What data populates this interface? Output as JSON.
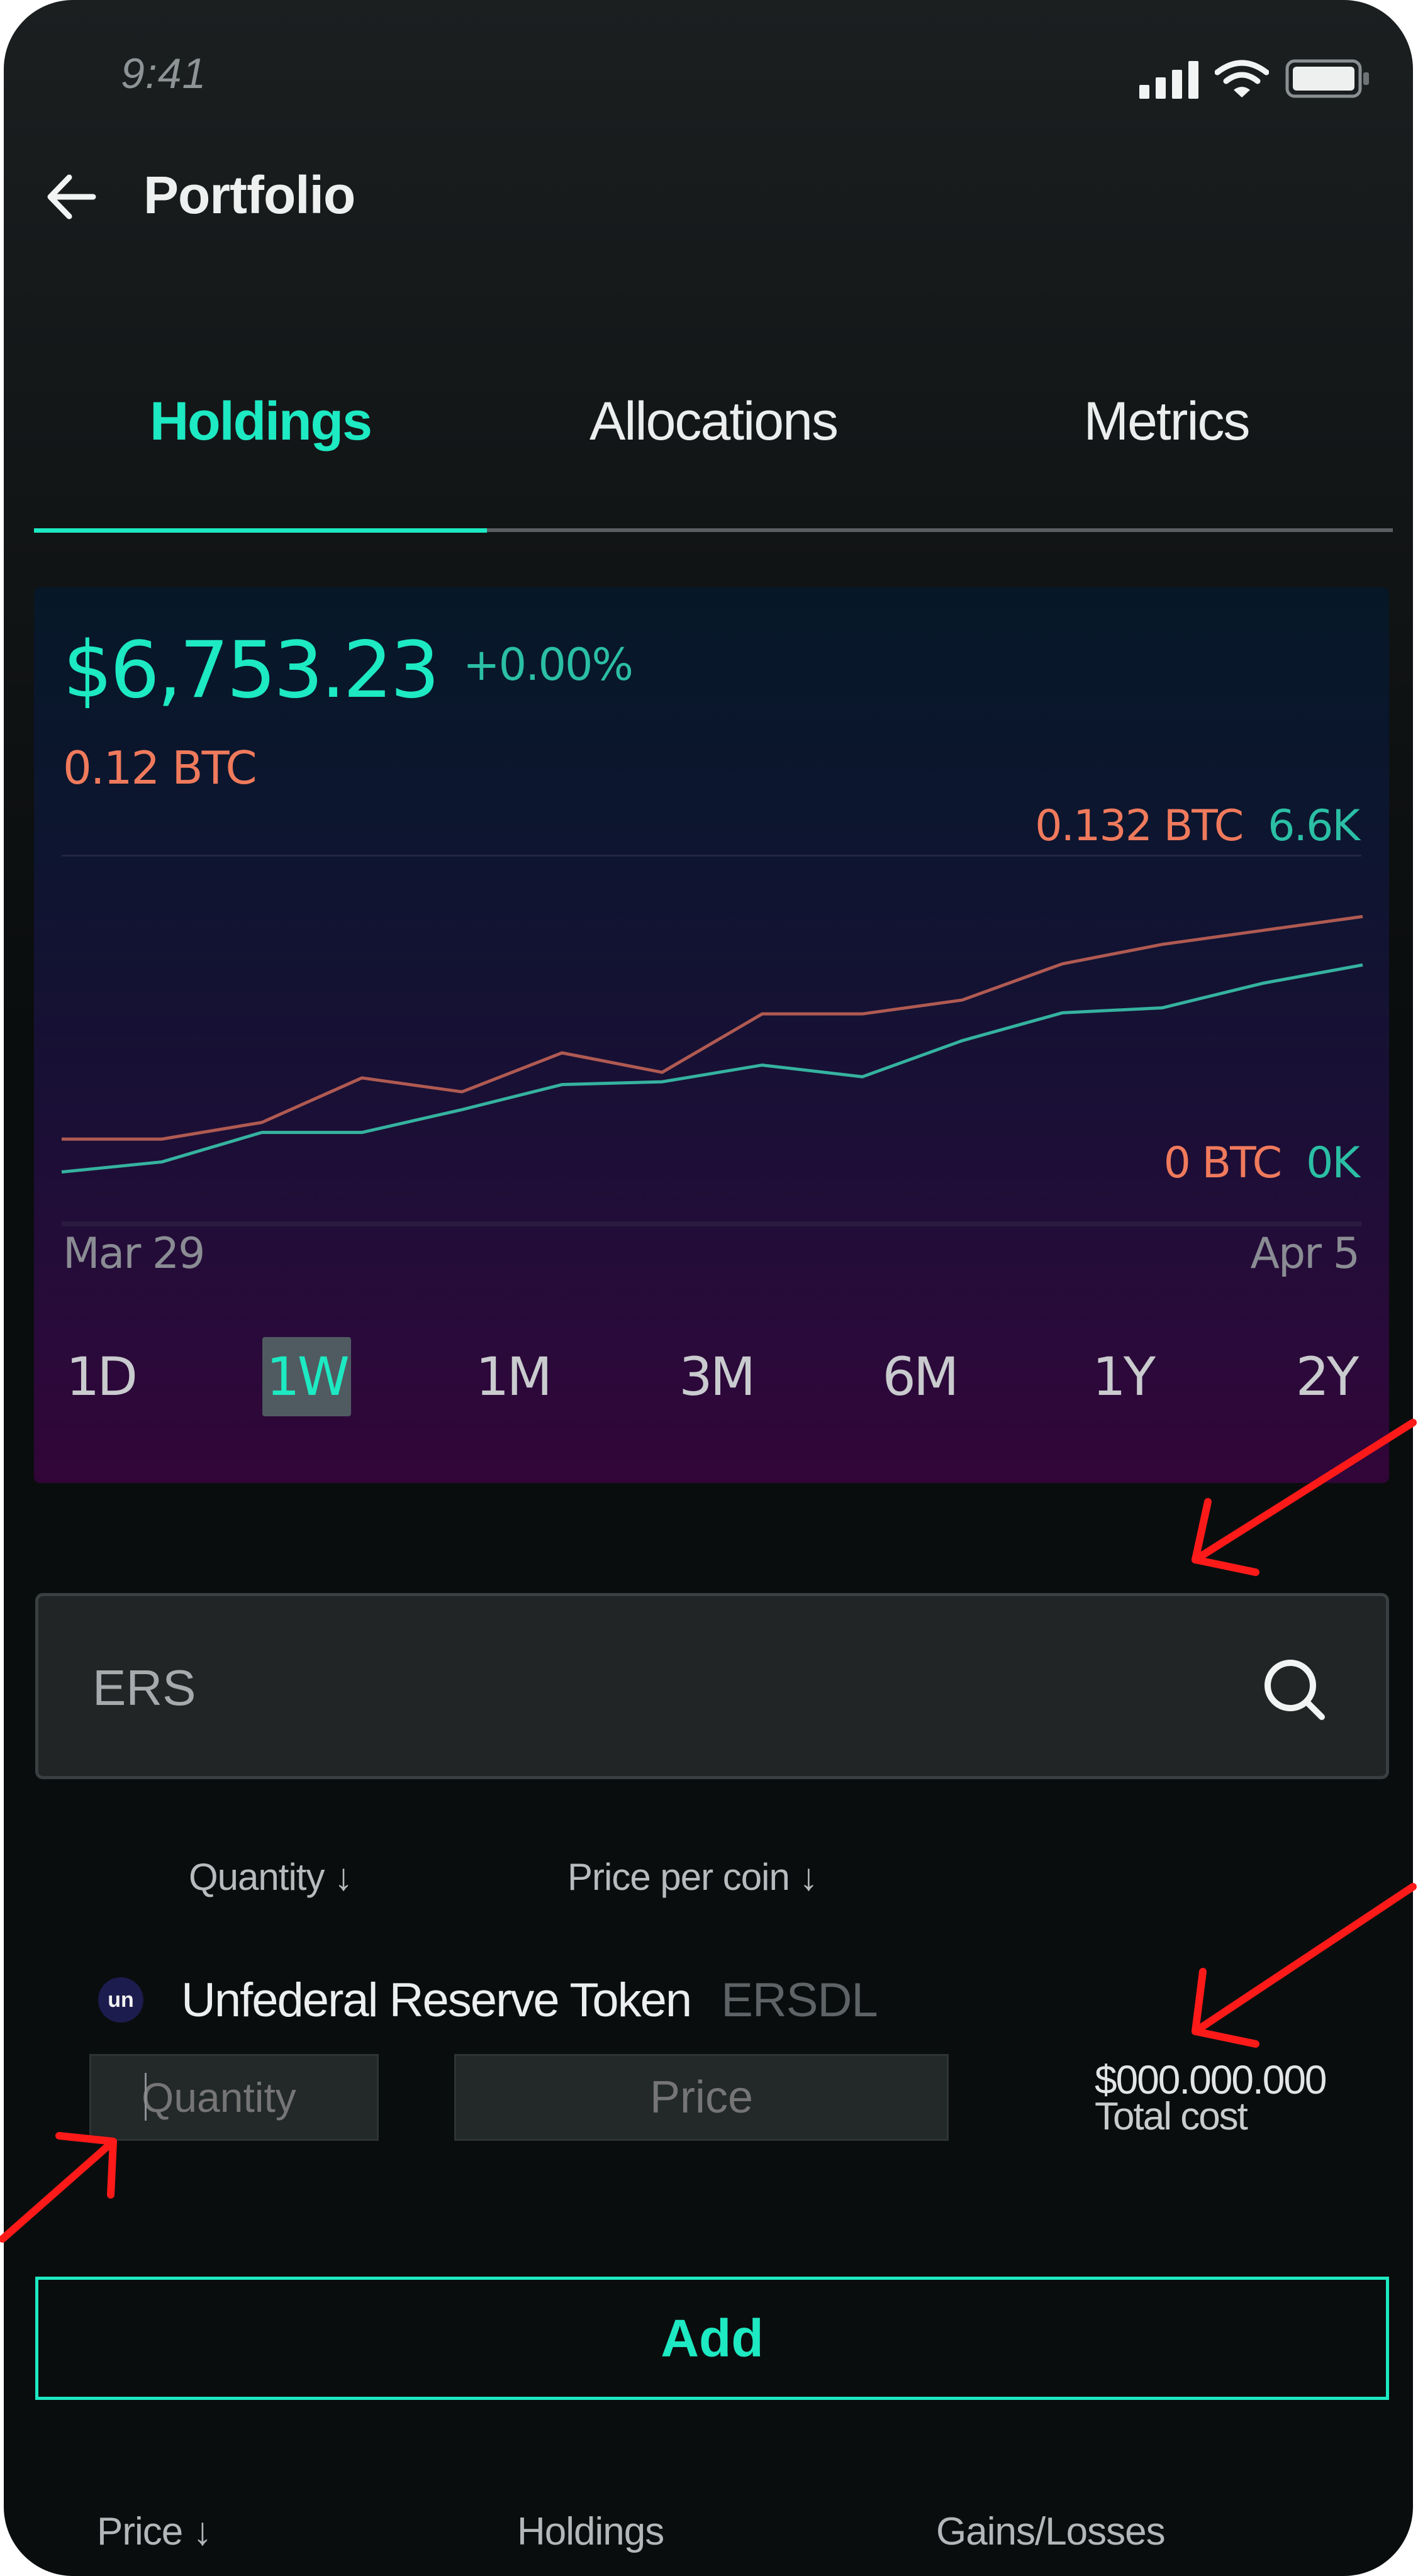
{
  "status_bar": {
    "time": "9:41",
    "icons": [
      "signal-icon",
      "wifi-icon",
      "battery-icon"
    ]
  },
  "header": {
    "back_icon": "arrow-left-icon",
    "title": "Portfolio"
  },
  "tabs": [
    {
      "label": "Holdings",
      "active": true
    },
    {
      "label": "Allocations",
      "active": false
    },
    {
      "label": "Metrics",
      "active": false
    }
  ],
  "summary": {
    "value": "$6,753.23",
    "change": "+0.00%",
    "btc_value": "0.12 BTC"
  },
  "chart_axis": {
    "max_btc": "0.132 BTC",
    "max_usd": "6.6K",
    "min_btc": "0 BTC",
    "min_usd": "0K",
    "start_date": "Mar 29",
    "end_date": "Apr 5"
  },
  "chart_data": {
    "type": "line",
    "title": "",
    "xlabel": "",
    "ylabel": "",
    "x_range": [
      "Mar 29",
      "Apr 5"
    ],
    "series": [
      {
        "name": "BTC",
        "color": "#b05a52",
        "unit": "BTC",
        "ylim": [
          0,
          0.132
        ],
        "values": [
          0.03,
          0.03,
          0.036,
          0.052,
          0.047,
          0.061,
          0.054,
          0.075,
          0.075,
          0.08,
          0.093,
          0.1,
          0.105,
          0.11
        ]
      },
      {
        "name": "USD",
        "color": "#35b3a0",
        "unit": "K",
        "ylim": [
          0,
          6.6
        ],
        "values": [
          0.91,
          1.09,
          1.62,
          1.62,
          2.03,
          2.48,
          2.53,
          2.83,
          2.62,
          3.27,
          3.77,
          3.86,
          4.3,
          4.63
        ]
      }
    ],
    "grid": false,
    "legend": "none"
  },
  "time_ranges": [
    {
      "label": "1D",
      "active": false
    },
    {
      "label": "1W",
      "active": true
    },
    {
      "label": "1M",
      "active": false
    },
    {
      "label": "3M",
      "active": false
    },
    {
      "label": "6M",
      "active": false
    },
    {
      "label": "1Y",
      "active": false
    },
    {
      "label": "2Y",
      "active": false
    }
  ],
  "search": {
    "value": "ERS",
    "icon": "search-icon"
  },
  "columns": {
    "quantity": "Quantity ↓",
    "price_per_coin": "Price per coin ↓"
  },
  "token": {
    "icon_text": "un",
    "name": "Unfederal Reserve Token",
    "symbol": "ERSDL"
  },
  "form": {
    "quantity_placeholder": "Quantity",
    "price_placeholder": "Price",
    "total_value": "$000.000.000",
    "total_label": "Total cost",
    "add_label": "Add"
  },
  "holdings_table": {
    "headers": [
      "Price ↓",
      "Holdings",
      "Gains/Losses"
    ]
  },
  "colors": {
    "accent": "#1de9c2",
    "btc": "#f07a5c",
    "usd": "#2bbfa5",
    "annotation": "#ff1a1a"
  }
}
